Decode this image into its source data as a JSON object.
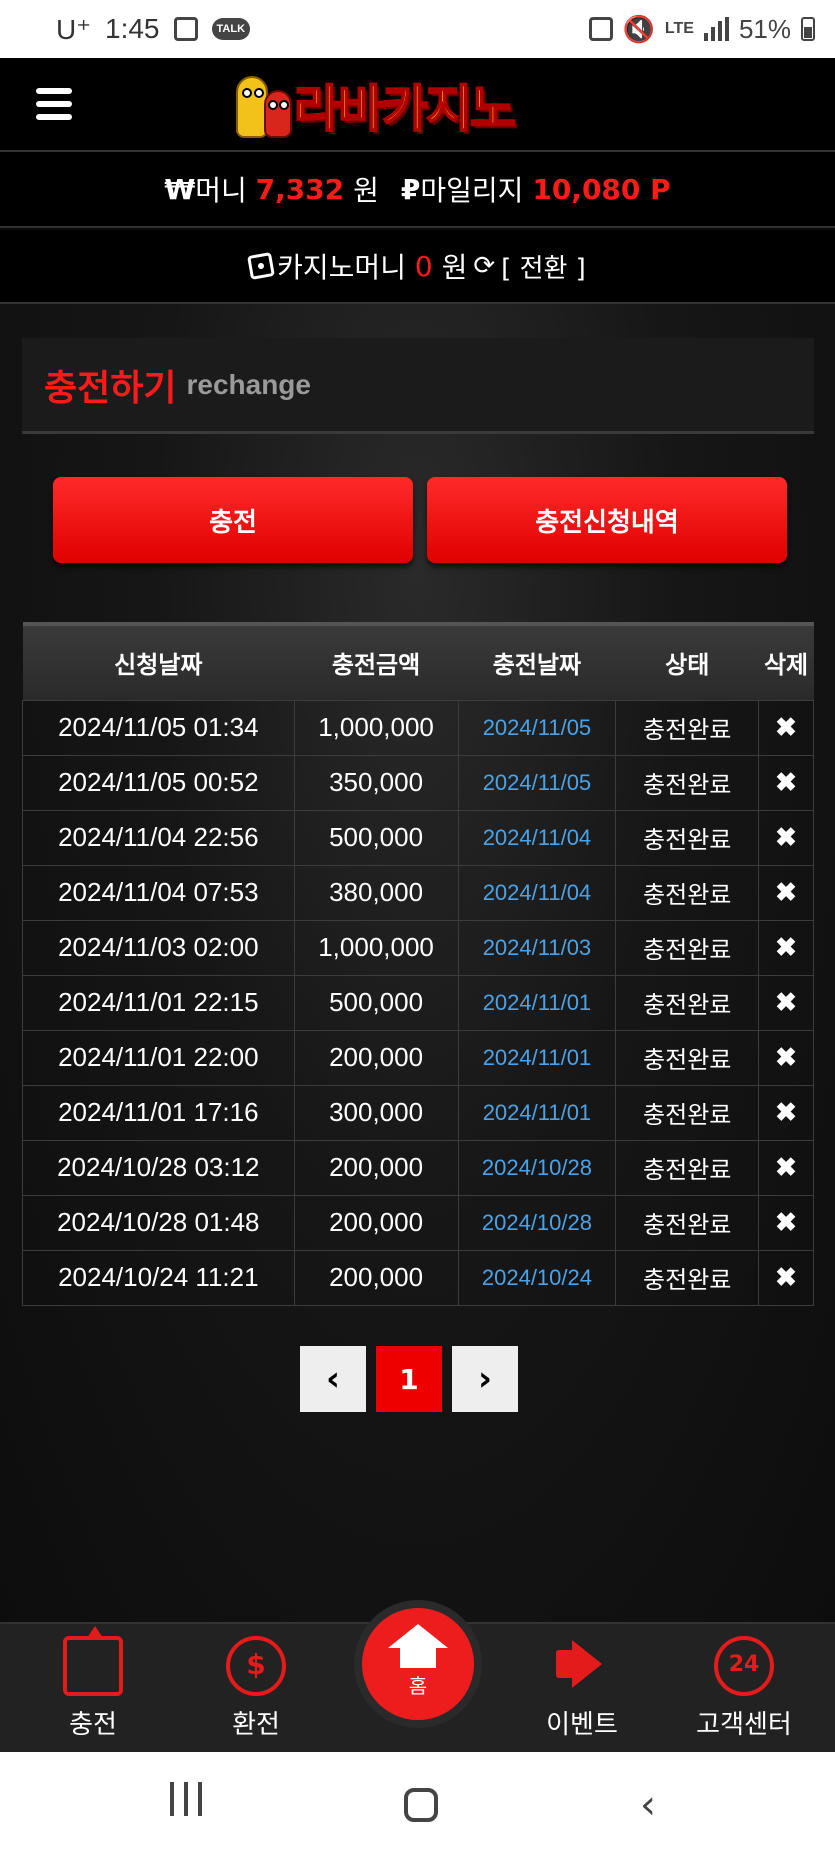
{
  "status_bar": {
    "carrier": "U⁺",
    "time": "1:45",
    "network": "LTE",
    "battery": "51%"
  },
  "header": {
    "logo_text": "라바카지노"
  },
  "balance": {
    "money_symbol": "₩",
    "money_label": "머니",
    "money_value": "7,332",
    "money_unit": "원",
    "mileage_symbol": "₽",
    "mileage_label": "마일리지",
    "mileage_value": "10,080 P",
    "casino_label": "카지노머니",
    "casino_value": "0",
    "casino_unit": "원",
    "convert_label": "[ 전환 ]"
  },
  "section": {
    "title_kr": "충전하기",
    "title_en": "rechange"
  },
  "buttons": {
    "charge": "충전",
    "history": "충전신청내역"
  },
  "table": {
    "headers": [
      "신청날짜",
      "충전금액",
      "충전날짜",
      "상태",
      "삭제"
    ],
    "rows": [
      [
        "2024/11/05 01:34",
        "1,000,000",
        "2024/11/05",
        "충전완료",
        "✖"
      ],
      [
        "2024/11/05 00:52",
        "350,000",
        "2024/11/05",
        "충전완료",
        "✖"
      ],
      [
        "2024/11/04 22:56",
        "500,000",
        "2024/11/04",
        "충전완료",
        "✖"
      ],
      [
        "2024/11/04 07:53",
        "380,000",
        "2024/11/04",
        "충전완료",
        "✖"
      ],
      [
        "2024/11/03 02:00",
        "1,000,000",
        "2024/11/03",
        "충전완료",
        "✖"
      ],
      [
        "2024/11/01 22:15",
        "500,000",
        "2024/11/01",
        "충전완료",
        "✖"
      ],
      [
        "2024/11/01 22:00",
        "200,000",
        "2024/11/01",
        "충전완료",
        "✖"
      ],
      [
        "2024/11/01 17:16",
        "300,000",
        "2024/11/01",
        "충전완료",
        "✖"
      ],
      [
        "2024/10/28 03:12",
        "200,000",
        "2024/10/28",
        "충전완료",
        "✖"
      ],
      [
        "2024/10/28 01:48",
        "200,000",
        "2024/10/28",
        "충전완료",
        "✖"
      ],
      [
        "2024/10/24 11:21",
        "200,000",
        "2024/10/24",
        "충전완료",
        "✖"
      ]
    ]
  },
  "pagination": {
    "prev": "‹",
    "current": "1",
    "next": "›"
  },
  "bottom_nav": {
    "charge": "충전",
    "exchange": "환전",
    "home": "홈",
    "event": "이벤트",
    "support": "고객센터"
  },
  "colors": {
    "accent": "#ff1a1a",
    "link_blue": "#4aa3e8",
    "background": "#0b0b0b"
  }
}
